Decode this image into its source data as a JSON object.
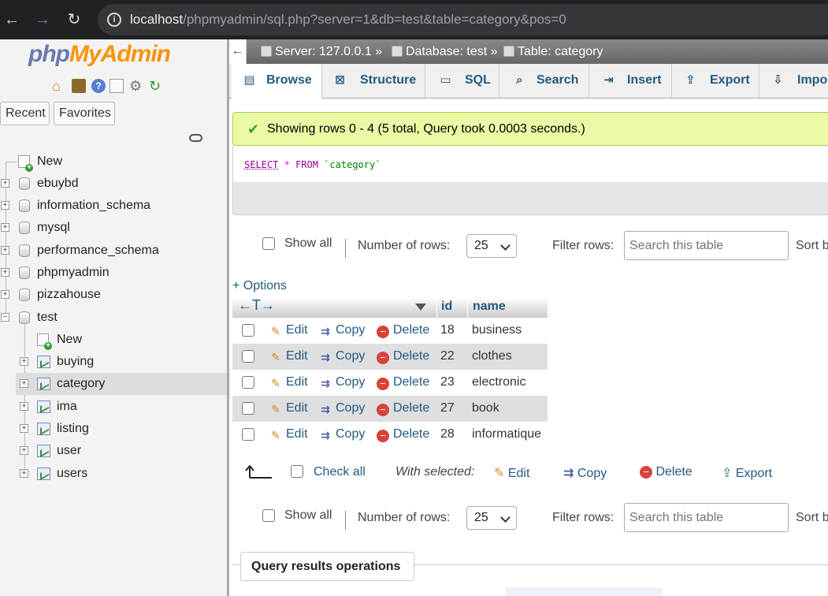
{
  "browser": {
    "url_host": "localhost",
    "url_path": "/phpmyadmin/sql.php?server=1&db=test&table=category&pos=0"
  },
  "logo": {
    "php": "php",
    "myadmin": "MyAdmin"
  },
  "nav_tabs": {
    "recent": "Recent",
    "favorites": "Favorites"
  },
  "tree": {
    "new_db": "New",
    "databases": [
      "ebuybd",
      "information_schema",
      "mysql",
      "performance_schema",
      "phpmyadmin",
      "pizzahouse",
      "test"
    ],
    "test_new": "New",
    "tables": [
      "buying",
      "category",
      "ima",
      "listing",
      "user",
      "users"
    ]
  },
  "breadcrumb": {
    "server": "Server: 127.0.0.1 »",
    "database": "Database: test »",
    "table": "Table: category"
  },
  "tabs": [
    "Browse",
    "Structure",
    "SQL",
    "Search",
    "Insert",
    "Export",
    "Impo"
  ],
  "success_msg": "Showing rows 0 - 4 (5 total, Query took 0.0003 seconds.)",
  "sql": {
    "select": "SELECT",
    "star": "*",
    "from": "FROM",
    "table": "`category`"
  },
  "controls": {
    "show_all": "Show all",
    "num_rows_label": "Number of rows:",
    "num_rows_value": "25",
    "filter_label": "Filter rows:",
    "filter_placeholder": "Search this table",
    "sort_label": "Sort b"
  },
  "options_link": "+ Options",
  "table": {
    "arrows": "←T→",
    "headers": {
      "id": "id",
      "name": "name"
    },
    "actions": {
      "edit": "Edit",
      "copy": "Copy",
      "delete": "Delete"
    },
    "rows": [
      {
        "id": "18",
        "name": "business"
      },
      {
        "id": "22",
        "name": "clothes"
      },
      {
        "id": "23",
        "name": "electronic"
      },
      {
        "id": "27",
        "name": "book"
      },
      {
        "id": "28",
        "name": "informatique"
      }
    ]
  },
  "with_selected": {
    "check_all": "Check all",
    "label": "With selected:",
    "edit": "Edit",
    "copy": "Copy",
    "delete": "Delete",
    "export": "Export"
  },
  "query_ops": "Query results operations"
}
